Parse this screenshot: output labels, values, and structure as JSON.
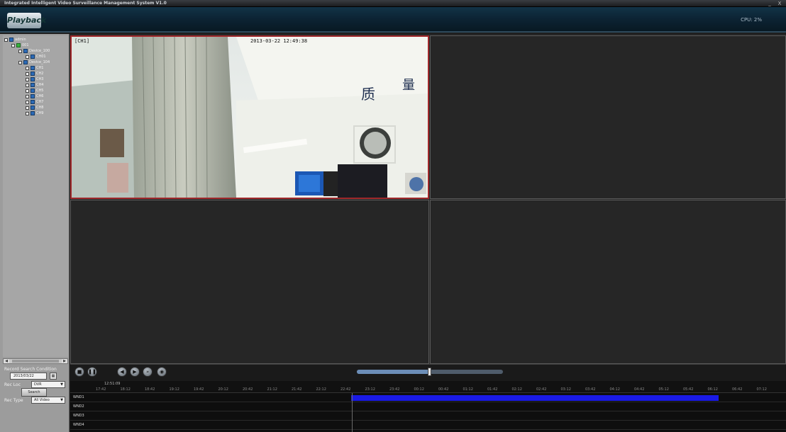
{
  "window": {
    "title": "Integrated Intelligent Video Surveillance Management System V1.0",
    "minimize": "_",
    "close": "X"
  },
  "header": {
    "logo_text": "Playback",
    "cpu_text": "CPU: 2%"
  },
  "tree": {
    "nodes": [
      {
        "label": "admin",
        "level": 0,
        "icon": "blue"
      },
      {
        "label": "001",
        "level": 1,
        "icon": "green"
      },
      {
        "label": "Device_100",
        "level": 2,
        "icon": "blue"
      },
      {
        "label": "CH01",
        "level": 3,
        "icon": "blue"
      },
      {
        "label": "Device_104",
        "level": 2,
        "icon": "blue"
      },
      {
        "label": "CH1",
        "level": 3,
        "icon": "blue"
      },
      {
        "label": "CH2",
        "level": 3,
        "icon": "blue"
      },
      {
        "label": "CH3",
        "level": 3,
        "icon": "blue"
      },
      {
        "label": "CH4",
        "level": 3,
        "icon": "blue"
      },
      {
        "label": "CH5",
        "level": 3,
        "icon": "blue"
      },
      {
        "label": "CH6",
        "level": 3,
        "icon": "blue"
      },
      {
        "label": "CH7",
        "level": 3,
        "icon": "blue"
      },
      {
        "label": "CH8",
        "level": 3,
        "icon": "blue"
      },
      {
        "label": "CH9",
        "level": 3,
        "icon": "blue"
      }
    ]
  },
  "search": {
    "section_label": "Record Search Condition",
    "rec_loc_label": "Rec Loc",
    "rec_loc_value": "DVR",
    "rec_type_label": "Rec Type",
    "rec_type_value": "All Video",
    "date_value": "2013/03/22",
    "calendar_icon": "calendar-icon",
    "search_button": "Search"
  },
  "video": {
    "pane1_channel": "[CH1]",
    "pane1_timestamp": "2013-03-22 12:49:38"
  },
  "controls": {
    "buttons": [
      "stop",
      "pause",
      "slow",
      "play",
      "fast",
      "capture"
    ],
    "zoom_position": 0.5
  },
  "timeline": {
    "current_time": "12:51:09",
    "ticks": [
      "17:42",
      "18:12",
      "18:42",
      "19:12",
      "19:42",
      "20:12",
      "20:42",
      "21:12",
      "21:42",
      "22:12",
      "22:42",
      "23:12",
      "23:42",
      "00:12",
      "00:42",
      "01:12",
      "01:42",
      "02:12",
      "02:42",
      "03:12",
      "03:42",
      "04:12",
      "04:42",
      "05:12",
      "05:42",
      "06:12",
      "06:42",
      "07:12"
    ],
    "channels": [
      "WND1",
      "WND2",
      "WND3",
      "WND4"
    ],
    "recording_start": 0.392,
    "recording_end": 0.906
  },
  "colors": {
    "recording": "#1a1ae6",
    "selected_pane": "#a0282b"
  }
}
